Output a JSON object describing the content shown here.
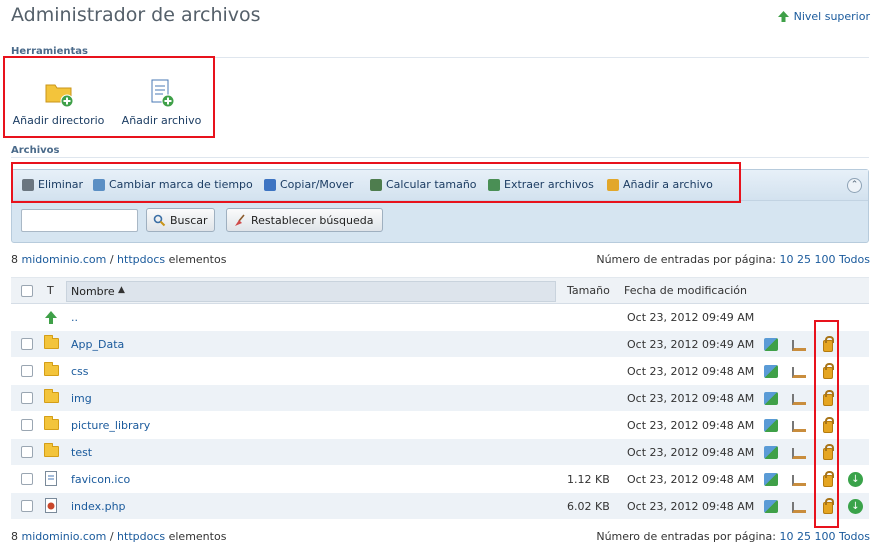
{
  "header": {
    "title": "Administrador de archivos",
    "up_link": "Nivel superior"
  },
  "tools": {
    "section_title": "Herramientas",
    "add_directory": "Añadir directorio",
    "add_file": "Añadir archivo"
  },
  "files": {
    "section_title": "Archivos",
    "toolbar": {
      "delete": "Eliminar",
      "timestamp": "Cambiar marca de tiempo",
      "copy_move": "Copiar/Mover",
      "calc_size": "Calcular tamaño",
      "extract": "Extraer archivos",
      "add_archive": "Añadir a archivo"
    },
    "search": {
      "value": "",
      "placeholder": "",
      "button": "Buscar",
      "reset": "Restablecer búsqueda"
    }
  },
  "breadcrumb": {
    "count": "8",
    "domain": "midominio.com",
    "separator": "/",
    "folder": "httpdocs",
    "suffix": "elementos"
  },
  "pagination": {
    "label": "Número de entradas por página:",
    "opt10": "10",
    "opt25": "25",
    "opt100": "100",
    "all": "Todos"
  },
  "table": {
    "col_type": "T",
    "col_name": "Nombre",
    "col_size": "Tamaño",
    "col_date": "Fecha de modificación",
    "rows": [
      {
        "name": "..",
        "size": "",
        "date": "Oct 23, 2012 09:49 AM"
      },
      {
        "name": "App_Data",
        "size": "",
        "date": "Oct 23, 2012 09:49 AM"
      },
      {
        "name": "css",
        "size": "",
        "date": "Oct 23, 2012 09:48 AM"
      },
      {
        "name": "img",
        "size": "",
        "date": "Oct 23, 2012 09:48 AM"
      },
      {
        "name": "picture_library",
        "size": "",
        "date": "Oct 23, 2012 09:48 AM"
      },
      {
        "name": "test",
        "size": "",
        "date": "Oct 23, 2012 09:48 AM"
      },
      {
        "name": "favicon.ico",
        "size": "1.12 KB",
        "date": "Oct 23, 2012 09:48 AM"
      },
      {
        "name": "index.php",
        "size": "6.02 KB",
        "date": "Oct 23, 2012 09:48 AM"
      }
    ]
  },
  "colors": {
    "accent": "#1a5a9c",
    "highlight_border": "#e8121c",
    "toolbar_bg": "#d6e5f1"
  },
  "icons": [
    "up-arrow-icon",
    "folder-add-icon",
    "file-add-icon",
    "trash-icon",
    "clock-icon",
    "copy-icon",
    "calculator-icon",
    "extract-icon",
    "archive-icon",
    "search-icon",
    "broom-icon",
    "collapse-icon",
    "folder-icon",
    "file-icon",
    "edit-icon",
    "rename-icon",
    "lock-icon",
    "download-icon"
  ]
}
